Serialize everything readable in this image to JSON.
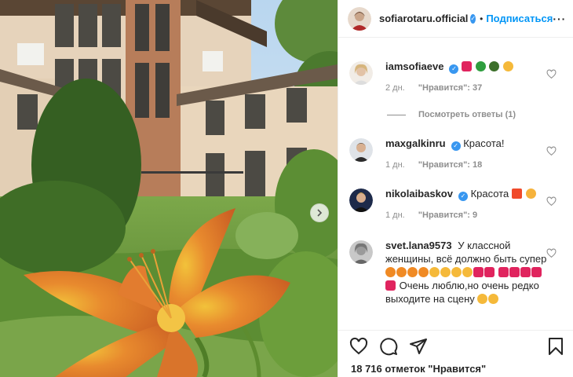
{
  "post": {
    "author": "sofiarotaru.official",
    "follow_label": "Подписаться",
    "dot": "•",
    "more_label": "···",
    "likes_text": "18 716 отметок \"Нравится\""
  },
  "comments": [
    {
      "user": "iamsofiaeve",
      "verified": true,
      "text": "",
      "emojis": [
        "heart-emoji",
        "four-leaf-clover-emoji",
        "face-emoji",
        "smiling-hearts-emoji"
      ],
      "age": "2 дн.",
      "likes": "\"Нравится\": 37"
    },
    {
      "user": "maxgalkinru",
      "verified": true,
      "text": "Красота!",
      "age": "1 дн.",
      "likes": "\"Нравится\": 18"
    },
    {
      "user": "nikolaibaskov",
      "verified": true,
      "text": "Красота",
      "emojis": [
        "collision-emoji",
        "kiss-emoji"
      ],
      "age": "1 дн.",
      "likes": "\"Нравится\": 9"
    },
    {
      "user": "svet.lana9573",
      "verified": false,
      "text_part1": "У классной женщины, всё должно быть супер",
      "text_part2": "Очень люблю,но очень редко выходите на сцену",
      "emojis": [
        "fire-emoji",
        "heart-eyes-emoji",
        "heart-emoji",
        "sad-emoji"
      ]
    }
  ],
  "replies_label": "Посмотреть ответы (1)",
  "colors": {
    "accent": "#0095f6",
    "verified": "#3897f0",
    "meta": "#8e8e8e",
    "text": "#262626"
  }
}
